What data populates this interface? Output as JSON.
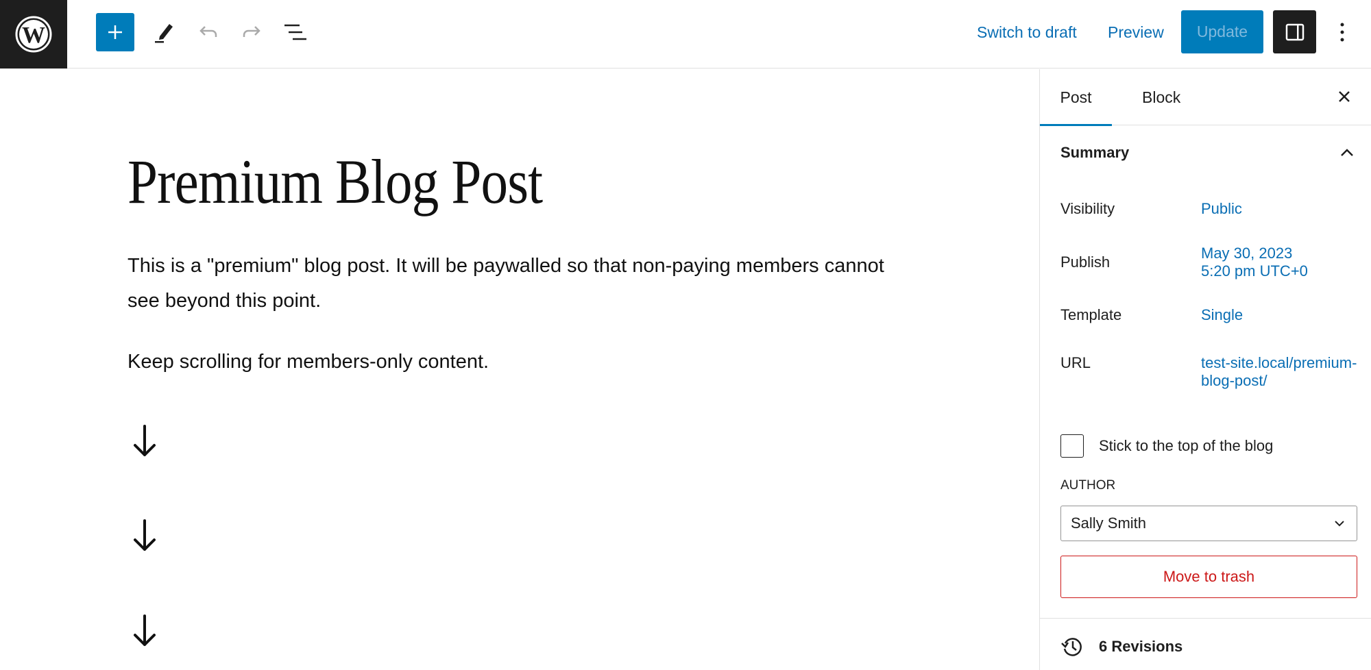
{
  "header": {
    "logo_icon": "wordpress-logo",
    "add_block_icon": "plus-icon",
    "tools": [
      {
        "icon": "pencil-icon",
        "label": "Tools"
      },
      {
        "icon": "undo-icon",
        "label": "Undo"
      },
      {
        "icon": "redo-icon",
        "label": "Redo"
      },
      {
        "icon": "list-view-icon",
        "label": "Document overview"
      }
    ],
    "switch_to_draft": "Switch to draft",
    "preview": "Preview",
    "update": "Update",
    "settings_icon": "sidebar-toggle-icon",
    "options_icon": "kebab-menu-icon"
  },
  "colors": {
    "accent": "#007cba",
    "link": "#0a6eb4",
    "danger": "#cc1818",
    "dark": "#1e1e1e"
  },
  "editor": {
    "title": "Premium Blog Post",
    "paragraphs": [
      "This is a \"premium\" blog post. It will be paywalled so that non-paying members cannot see beyond this point.",
      "Keep scrolling for members-only content."
    ],
    "arrows": [
      "↓",
      "↓",
      "↓"
    ]
  },
  "sidebar": {
    "tabs": [
      {
        "label": "Post",
        "active": true
      },
      {
        "label": "Block",
        "active": false
      }
    ],
    "summary": {
      "title": "Summary",
      "rows": {
        "visibility": {
          "label": "Visibility",
          "value": "Public"
        },
        "publish": {
          "label": "Publish",
          "value_line1": "May 30, 2023",
          "value_line2": "5:20 pm UTC+0"
        },
        "template": {
          "label": "Template",
          "value": "Single"
        },
        "url": {
          "label": "URL",
          "value": "test-site.local/premium-blog-post/"
        }
      },
      "sticky": {
        "label": "Stick to the top of the blog",
        "checked": false
      },
      "author": {
        "label": "AUTHOR",
        "selected": "Sally Smith"
      },
      "trash": "Move to trash"
    },
    "revisions": "6 Revisions"
  }
}
